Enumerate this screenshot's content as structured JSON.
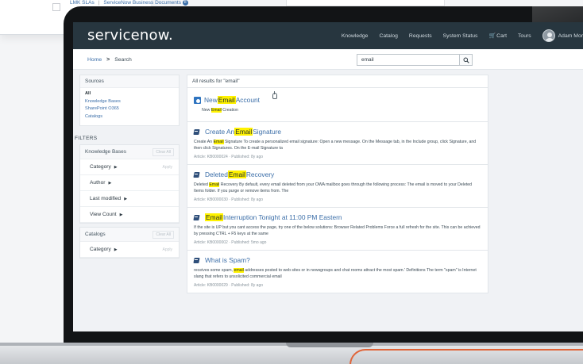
{
  "background": {
    "strip_left": "LMK SLAs",
    "strip_right": "ServiceNow Business Documents",
    "badge_count": "8"
  },
  "header": {
    "logo": "servicenow.",
    "nav": [
      "Knowledge",
      "Catalog",
      "Requests",
      "System Status"
    ],
    "cart": "Cart",
    "tours": "Tours",
    "user": "Adam Mor"
  },
  "breadcrumb": {
    "home": "Home",
    "current": "Search"
  },
  "search": {
    "value": "email"
  },
  "sidebar": {
    "sources_title": "Sources",
    "sources": [
      "All",
      "Knowledge Bases",
      "SharePoint O365",
      "Catalogs"
    ],
    "filters_label": "FILTERS",
    "knowledge_bases": {
      "title": "Knowledge Bases",
      "clear": "Clear All",
      "rows": [
        {
          "label": "Category",
          "action": "Apply"
        },
        {
          "label": "Author",
          "action": ""
        },
        {
          "label": "Last modified",
          "action": ""
        },
        {
          "label": "View Count",
          "action": ""
        }
      ]
    },
    "catalogs": {
      "title": "Catalogs",
      "clear": "Clear All",
      "rows": [
        {
          "label": "Category",
          "action": "Apply"
        }
      ]
    }
  },
  "results": {
    "header": "All results for \"email\"",
    "items": [
      {
        "icon": "outlook-icon",
        "title_pre": "New ",
        "title_hl": "Email",
        "title_post": " Account",
        "body_pre": "New ",
        "body_hl": "Email",
        "body_post": " Creation",
        "meta": ""
      },
      {
        "icon": "book-icon",
        "title_pre": "Create An ",
        "title_hl": "Email",
        "title_post": " Signature",
        "body_pre": "Create An ",
        "body_hl": "Email",
        "body_post": " Signature To create a personalized email signature: Open a new message. On the Message tab, in the Include group, click Signature, and then click Signatures. On the E-mail Signature ta",
        "meta": "Article: KB0000024 · Published: 8y ago"
      },
      {
        "icon": "book-icon",
        "title_pre": "Deleted ",
        "title_hl": "Email",
        "title_post": " Recovery",
        "body_pre": "Deleted ",
        "body_hl": "Email",
        "body_post": " Recovery By default, every email deleted from your OWA mailbox goes through the following process: The email is moved to your Deleted Items folder. If you purge or remove items from. The",
        "meta": "Article: KB0000030 · Published: 8y ago"
      },
      {
        "icon": "book-icon",
        "title_pre": "",
        "title_hl": "Email",
        "title_post": " Interruption Tonight at 11:00 PM Eastern",
        "body_pre": "If the site is UP but you cant access the page, try one of the below solutions: Browser Related Problems Force a full refresh for the site. This can be achieved by pressing CTRL + F5 keys at the same",
        "body_hl": "",
        "body_post": "",
        "meta": "Article: KB0000002 · Published: 5mo ago"
      },
      {
        "icon": "book-icon",
        "title_pre": "What is Spam?",
        "title_hl": "",
        "title_post": "",
        "body_pre": "receives some spam, ",
        "body_hl": "email",
        "body_post": " addresses posted to web sites or in newsgroups and chat rooms attract the most spam.' Definitions The term \"spam\" is Internet slang that refers to unsolicited commercial email",
        "meta": "Article: KB0000029 · Published: 8y ago"
      }
    ]
  },
  "colors": {
    "header_bg": "#27363f",
    "link": "#3b6ea8",
    "highlight": "#fff200",
    "accent": "#e0653a"
  }
}
